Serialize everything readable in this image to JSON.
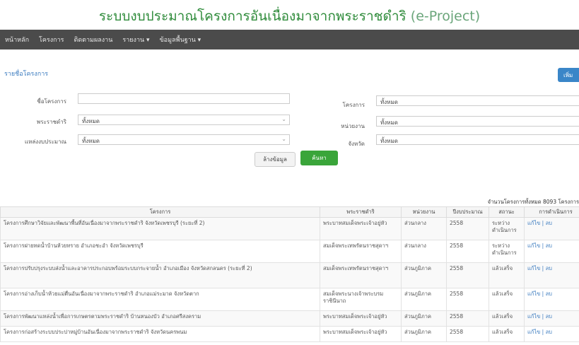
{
  "header": {
    "title_th": "ระบบงบประมาณโครงการอันเนื่องมาจากพระราชดำริ",
    "title_en": "(e-Project)"
  },
  "nav": {
    "items": [
      "หน้าหลัก",
      "โครงการ",
      "ติดตามผลงาน",
      "รายงาน ▾",
      "ข้อมูลพื้นฐาน ▾"
    ]
  },
  "page": {
    "heading": "รายชื่อโครงการ",
    "add_button": "เพิ่ม"
  },
  "filters": {
    "project_name_label": "ชื่อโครงการ",
    "project_name_value": "",
    "royal_label": "พระราชดำริ",
    "royal_value": "ทั้งหมด",
    "budget_source_label": "แหล่งงบประมาณ",
    "budget_source_value": "ทั้งหมด",
    "project_type_label": "โครงการ",
    "project_type_value": "ทั้งหมด",
    "agency_label": "หน่วยงาน",
    "agency_value": "ทั้งหมด",
    "province_label": "จังหวัด",
    "province_value": "ทั้งหมด"
  },
  "buttons": {
    "clear": "ล้างข้อมูล",
    "search": "ค้นหา"
  },
  "results": {
    "count_text": "จำนวนโครงการทั้งหมด 8093 โครงการ"
  },
  "table": {
    "columns": [
      "โครงการ",
      "พระราชดำริ",
      "หน่วยงาน",
      "ปีงบประมาณ",
      "สถานะ",
      "การดำเนินการ"
    ],
    "rows": [
      {
        "project": "โครงการศึกษาวิจัยและพัฒนาพื้นที่อันเนื่องมาจากพระราชดำริ จังหวัดเพชรบุรี (ระยะที่ 2)",
        "royal": "พระบาทสมเด็จพระเจ้าอยู่หัว",
        "agency": "ส่วนกลาง",
        "year": "2558",
        "status": "ระหว่างดำเนินการ",
        "action": "แก้ไข | ลบ"
      },
      {
        "project": "โครงการฝายทดน้ำบ้านห้วยทราย อำเภอชะอำ จังหวัดเพชรบุรี",
        "royal": "สมเด็จพระเทพรัตนราชสุดาฯ",
        "agency": "ส่วนกลาง",
        "year": "2558",
        "status": "ระหว่างดำเนินการ",
        "action": "แก้ไข | ลบ"
      },
      {
        "project": "โครงการปรับปรุงระบบส่งน้ำและอาคารประกอบพร้อมระบบกระจายน้ำ อำเภอเมือง จังหวัดสกลนคร (ระยะที่ 2)",
        "royal": "สมเด็จพระเทพรัตนราชสุดาฯ",
        "agency": "ส่วนภูมิภาค",
        "year": "2558",
        "status": "แล้วเสร็จ",
        "action": "แก้ไข | ลบ"
      },
      {
        "project": "โครงการอ่างเก็บน้ำห้วยแม่ตื่นอันเนื่องมาจากพระราชดำริ อำเภอแม่ระมาด จังหวัดตาก",
        "royal": "สมเด็จพระนางเจ้าพระบรมราชินีนาถ",
        "agency": "ส่วนภูมิภาค",
        "year": "2558",
        "status": "แล้วเสร็จ",
        "action": "แก้ไข | ลบ"
      },
      {
        "project": "โครงการพัฒนาแหล่งน้ำเพื่อการเกษตรตามพระราชดำริ บ้านหนองบัว อำเภอศรีสงคราม",
        "royal": "พระบาทสมเด็จพระเจ้าอยู่หัว",
        "agency": "ส่วนภูมิภาค",
        "year": "2558",
        "status": "แล้วเสร็จ",
        "action": "แก้ไข | ลบ"
      },
      {
        "project": "โครงการก่อสร้างระบบประปาหมู่บ้านอันเนื่องมาจากพระราชดำริ จังหวัดนครพนม",
        "royal": "พระบาทสมเด็จพระเจ้าอยู่หัว",
        "agency": "ส่วนภูมิภาค",
        "year": "2558",
        "status": "แล้วเสร็จ",
        "action": "แก้ไข | ลบ"
      }
    ]
  }
}
